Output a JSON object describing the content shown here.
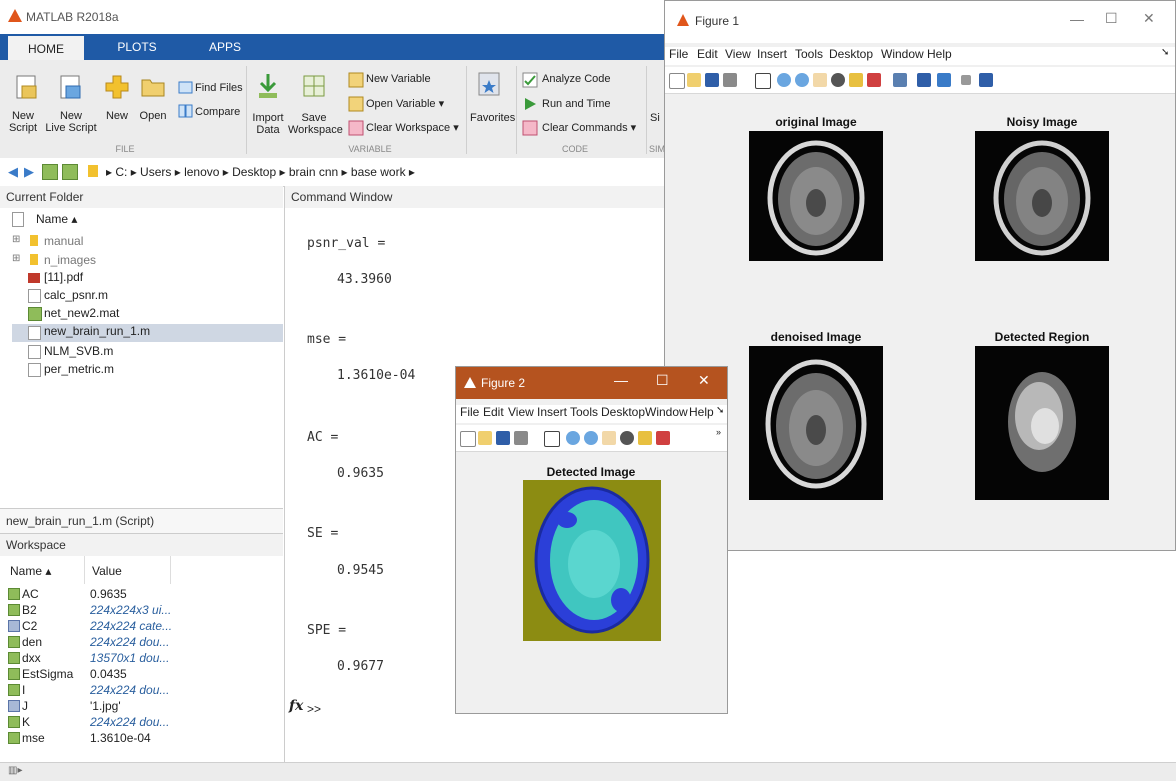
{
  "app": {
    "title": "MATLAB R2018a"
  },
  "ribbon": {
    "tabs": [
      "HOME",
      "PLOTS",
      "APPS"
    ],
    "new_script": "New\nScript",
    "new_live_script": "New\nLive Script",
    "new": "New",
    "open": "Open",
    "find_files": "Find Files",
    "compare": "Compare",
    "import_data": "Import\nData",
    "save_workspace": "Save\nWorkspace",
    "new_variable": "New Variable",
    "open_variable": "Open Variable ▾",
    "clear_workspace": "Clear Workspace ▾",
    "favorites": "Favorites",
    "analyze_code": "Analyze Code",
    "run_and_time": "Run and Time",
    "clear_commands": "Clear Commands ▾",
    "simulink_partial": "Si",
    "sections": [
      "FILE",
      "VARIABLE",
      "CODE",
      "SIM"
    ]
  },
  "address": {
    "segments": "▸ C: ▸ Users ▸ lenovo ▸ Desktop ▸ brain cnn ▸ base work ▸"
  },
  "current_folder": {
    "title": "Current Folder",
    "name_col": "Name ▴",
    "items": [
      {
        "name": "manual",
        "type": "folder"
      },
      {
        "name": "n_images",
        "type": "folder"
      },
      {
        "name": "[11].pdf",
        "type": "pdf"
      },
      {
        "name": "calc_psnr.m",
        "type": "m"
      },
      {
        "name": "net_new2.mat",
        "type": "mat"
      },
      {
        "name": "new_brain_run_1.m",
        "type": "m"
      },
      {
        "name": "NLM_SVB.m",
        "type": "m"
      },
      {
        "name": "per_metric.m",
        "type": "m"
      }
    ],
    "selected": "new_brain_run_1.m",
    "script_label": "new_brain_run_1.m  (Script)"
  },
  "workspace": {
    "title": "Workspace",
    "col_name": "Name ▴",
    "col_value": "Value",
    "rows": [
      {
        "name": "AC",
        "value": "0.9635",
        "italic": false
      },
      {
        "name": "B2",
        "value": "224x224x3 ui...",
        "italic": true
      },
      {
        "name": "C2",
        "value": "224x224 cate...",
        "italic": true
      },
      {
        "name": "den",
        "value": "224x224 dou...",
        "italic": true
      },
      {
        "name": "dxx",
        "value": "13570x1 dou...",
        "italic": true
      },
      {
        "name": "EstSigma",
        "value": "0.0435",
        "italic": false
      },
      {
        "name": "I",
        "value": "224x224 dou...",
        "italic": true
      },
      {
        "name": "J",
        "value": "'1.jpg'",
        "italic": false
      },
      {
        "name": "K",
        "value": "224x224 dou...",
        "italic": true
      },
      {
        "name": "mse",
        "value": "1.3610e-04",
        "italic": false
      }
    ]
  },
  "command_window": {
    "title": "Command Window",
    "lines": [
      {
        "text": "psnr_val ="
      },
      {
        "text": "43.3960"
      },
      {
        "text": "mse ="
      },
      {
        "text": "1.3610e-04"
      },
      {
        "text": "AC ="
      },
      {
        "text": "0.9635"
      },
      {
        "text": "SE ="
      },
      {
        "text": "0.9545"
      },
      {
        "text": "SPE ="
      },
      {
        "text": "0.9677"
      }
    ],
    "prompt": ">>",
    "fx": "fx"
  },
  "figure1": {
    "title": "Figure 1",
    "menu": [
      "File",
      "Edit",
      "View",
      "Insert",
      "Tools",
      "Desktop",
      "Window",
      "Help"
    ],
    "subplot_titles": [
      "original Image",
      "Noisy Image",
      "denoised Image",
      "Detected Region"
    ]
  },
  "figure2": {
    "title": "Figure 2",
    "menu": [
      "File",
      "Edit",
      "View",
      "Insert",
      "Tools",
      "Desktop",
      "Window",
      "Help"
    ],
    "image_title": "Detected Image"
  },
  "colors": {
    "ribbon_tab_bar": "#1f5aa6",
    "figure2_title_bar": "#b5531f",
    "selected_row": "#cfd7e3",
    "detected_background": "#8c8c12",
    "detected_tumor": "#40c6c0",
    "detected_edge": "#2b3fd8"
  }
}
